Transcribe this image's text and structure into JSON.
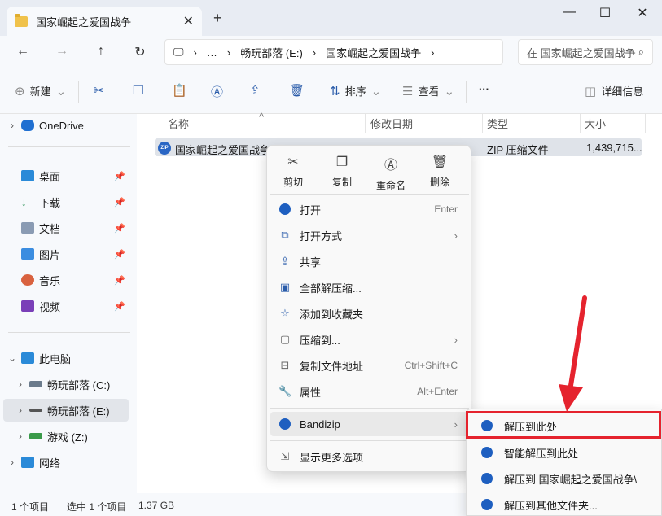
{
  "window": {
    "tab_title": "国家崛起之爱国战争",
    "new_tab": "+",
    "min": "—",
    "max": "☐",
    "close": "✕"
  },
  "nav": {
    "back": "←",
    "forward": "→",
    "up": "↑",
    "refresh": "↻",
    "crumbs": [
      "…",
      "畅玩部落 (E:)",
      "国家崛起之爱国战争"
    ],
    "search_placeholder": "在 国家崛起之爱国战争 中搜索"
  },
  "toolbar": {
    "new": "新建",
    "sort": "排序",
    "view": "查看",
    "more": "···",
    "details": "详细信息"
  },
  "sidebar": {
    "items": [
      "OneDrive",
      "桌面",
      "下载",
      "文档",
      "图片",
      "音乐",
      "视频",
      "此电脑",
      "畅玩部落 (C:)",
      "畅玩部落 (E:)",
      "游戏 (Z:)",
      "网络"
    ]
  },
  "columns": {
    "name": "名称",
    "date": "修改日期",
    "type": "类型",
    "size": "大小"
  },
  "file": {
    "name": "国家崛起之爱国战争",
    "type": "ZIP 压缩文件",
    "size": "1,439,715...",
    "icon": "ZIP"
  },
  "status": {
    "count": "1 个项目",
    "selected": "选中 1 个项目",
    "size": "1.37 GB"
  },
  "context_menu": {
    "quick": [
      "剪切",
      "复制",
      "重命名",
      "删除"
    ],
    "items": [
      {
        "label": "打开",
        "shortcut": "Enter"
      },
      {
        "label": "打开方式",
        "shortcut": ""
      },
      {
        "label": "共享",
        "shortcut": ""
      },
      {
        "label": "全部解压缩...",
        "shortcut": ""
      },
      {
        "label": "添加到收藏夹",
        "shortcut": ""
      },
      {
        "label": "压缩到...",
        "shortcut": ""
      },
      {
        "label": "复制文件地址",
        "shortcut": "Ctrl+Shift+C"
      },
      {
        "label": "属性",
        "shortcut": "Alt+Enter"
      },
      {
        "label": "Bandizip",
        "shortcut": ""
      },
      {
        "label": "显示更多选项",
        "shortcut": ""
      }
    ]
  },
  "submenu": {
    "items": [
      "解压到此处",
      "智能解压到此处",
      "解压到 国家崛起之爱国战争\\",
      "解压到其他文件夹..."
    ]
  },
  "accent": "#2a5caa",
  "highlight_color": "#e5232e"
}
